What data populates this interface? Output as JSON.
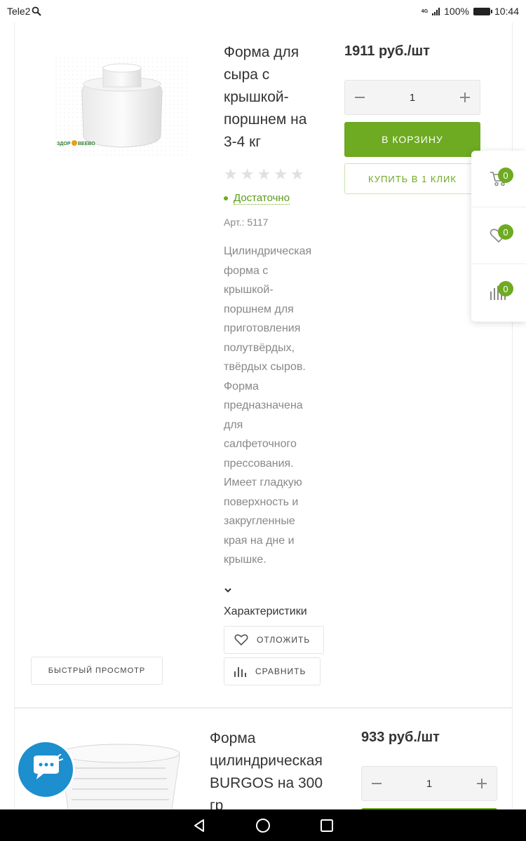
{
  "status_bar": {
    "carrier": "Tele2",
    "network": "4G",
    "battery": "100%",
    "time": "10:44"
  },
  "product1": {
    "title_lines": [
      "Форма для",
      "сыра с",
      "крышкой-",
      "поршнем на",
      "3-4 кг"
    ],
    "brand_logo_text": "ЗДОРОВЕЕВО",
    "price": "1911 руб./шт",
    "quantity": "1",
    "add_to_cart": "В КОРЗИНУ",
    "one_click": "КУПИТЬ В 1 КЛИК",
    "rating": 0,
    "rating_max": 5,
    "stock": "Достаточно",
    "article": "Арт.: 5117",
    "description_lines": [
      "Цилиндрическая",
      "форма с",
      "крышкой-",
      "поршнем для",
      "приготовления",
      "полутвёрдых,",
      "твёрдых сыров.",
      "Форма",
      "предназначена",
      "для",
      "салфеточного",
      "прессования.",
      "Имеет гладкую",
      "поверхность и",
      "закругленные",
      "края на дне и",
      "крышке."
    ],
    "characteristics": "Характеристики",
    "defer_label": "ОТЛОЖИТЬ",
    "compare_label": "СРАВНИТЬ",
    "quick_view": "БЫСТРЫЙ ПРОСМОТР"
  },
  "product2": {
    "title_lines": [
      "Форма",
      "цилиндрическая",
      "BURGOS на 300",
      "гр"
    ],
    "price": "933 руб./шт",
    "quantity": "1"
  },
  "side_panel": {
    "cart_count": "0",
    "favorites_count": "0",
    "compare_count": "0"
  },
  "colors": {
    "accent": "#6eaa22",
    "chat": "#1d8fce"
  }
}
